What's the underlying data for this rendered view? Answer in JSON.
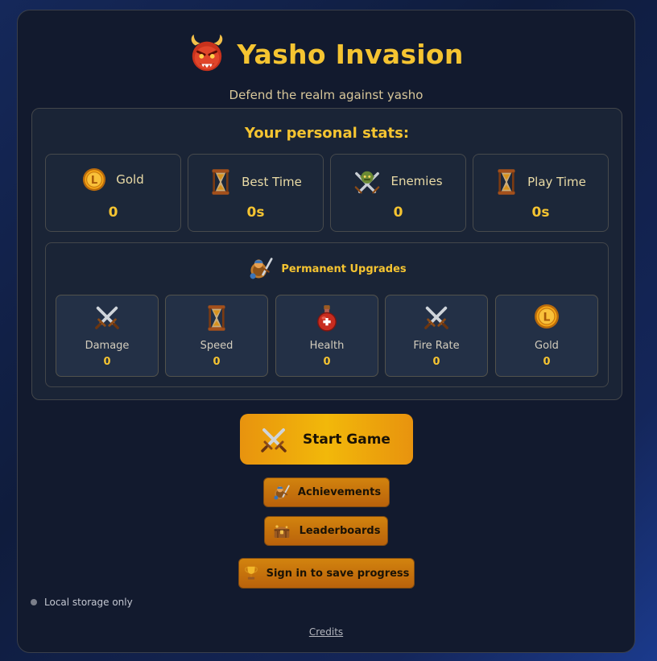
{
  "header": {
    "title": "Yasho Invasion",
    "subtitle": "Defend the realm against yasho",
    "logo_icon": "demon-face-icon"
  },
  "stats": {
    "title": "Your personal stats:",
    "items": [
      {
        "label": "Gold",
        "value": "0",
        "icon": "gold-coin-icon"
      },
      {
        "label": "Best Time",
        "value": "0s",
        "icon": "hourglass-icon"
      },
      {
        "label": "Enemies",
        "value": "0",
        "icon": "goblin-swords-icon"
      },
      {
        "label": "Play Time",
        "value": "0s",
        "icon": "hourglass-icon"
      }
    ]
  },
  "upgrades": {
    "title": "Permanent Upgrades",
    "icon": "hero-upgrade-icon",
    "items": [
      {
        "label": "Damage",
        "value": "0",
        "icon": "crossed-swords-icon"
      },
      {
        "label": "Speed",
        "value": "0",
        "icon": "hourglass-icon"
      },
      {
        "label": "Health",
        "value": "0",
        "icon": "health-potion-icon"
      },
      {
        "label": "Fire Rate",
        "value": "0",
        "icon": "crossed-swords-icon"
      },
      {
        "label": "Gold",
        "value": "0",
        "icon": "gold-coin-icon"
      }
    ]
  },
  "buttons": {
    "start": "Start Game",
    "achievements": "Achievements",
    "leaderboards": "Leaderboards",
    "signin": "Sign in to save progress"
  },
  "footer": {
    "storage": "Local storage only",
    "credits": "Credits"
  },
  "colors": {
    "accent": "#f5c431",
    "panel": "#121a2e",
    "button_orange": "#e8930e"
  }
}
